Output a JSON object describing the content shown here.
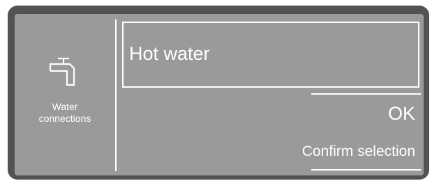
{
  "side_panel": {
    "icon": "water-tap-icon",
    "label_line1": "Water",
    "label_line2": "connections"
  },
  "selection": {
    "value": "Hot water"
  },
  "actions": {
    "ok_label": "OK",
    "confirm_label": "Confirm selection"
  },
  "colors": {
    "bezel": "#525252",
    "screen": "#9a9a9a",
    "foreground": "#ffffff"
  }
}
